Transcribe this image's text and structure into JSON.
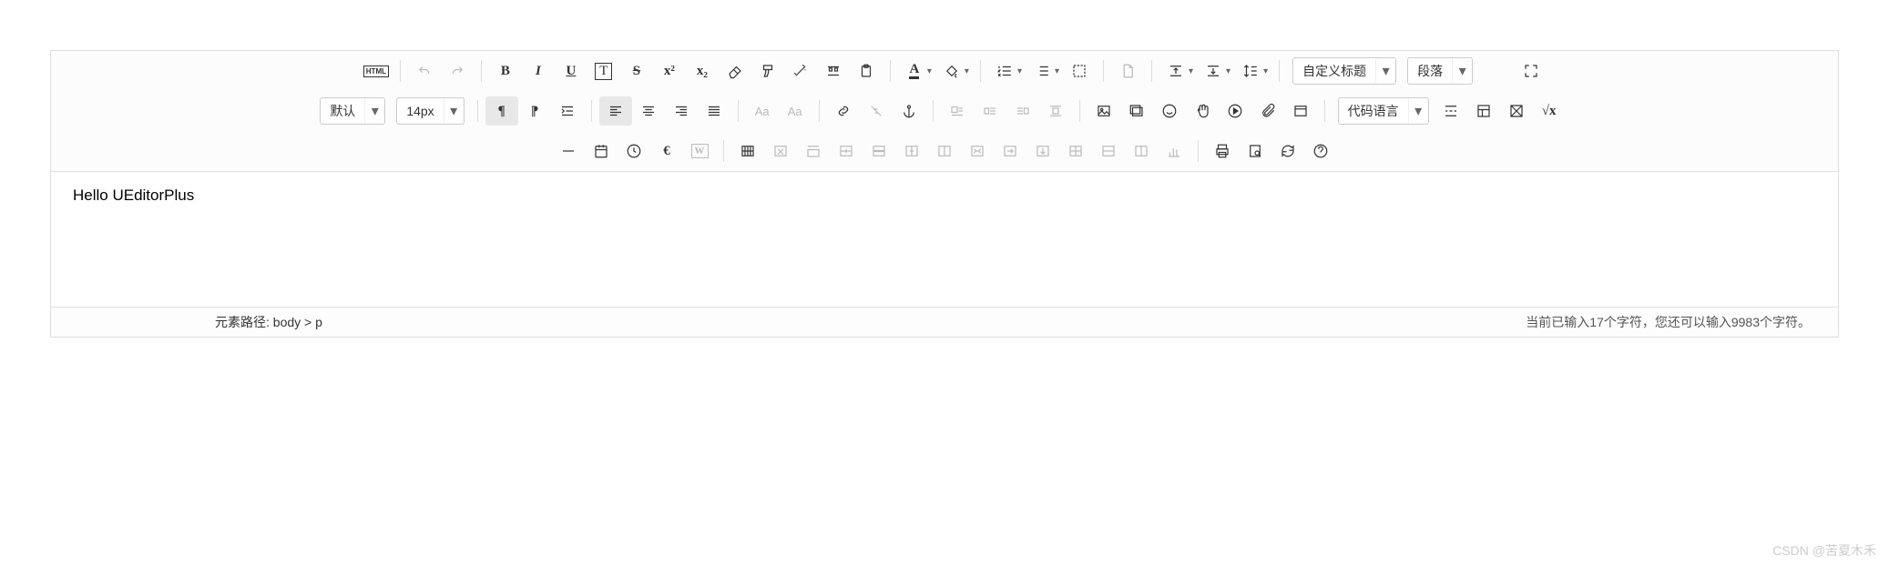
{
  "toolbar": {
    "html_btn": "HTML",
    "bold": "B",
    "italic": "I",
    "underline": "U",
    "typeface": "T",
    "strike": "S",
    "superscript": "x²",
    "subscript": "x₂",
    "forecolor": "A",
    "backcolor": "A",
    "custom_heading": "自定义标题",
    "paragraph": "段落",
    "font_family": "默认",
    "font_size": "14px",
    "font_case1": "Aa",
    "font_case2": "Aa",
    "code_lang": "代码语言"
  },
  "content": {
    "text": "Hello UEditorPlus"
  },
  "status": {
    "path_label": "元素路径: ",
    "path_value": "body > p",
    "char_count": "当前已输入17个字符，您还可以输入9983个字符。"
  },
  "watermark": "CSDN @苦夏木禾"
}
